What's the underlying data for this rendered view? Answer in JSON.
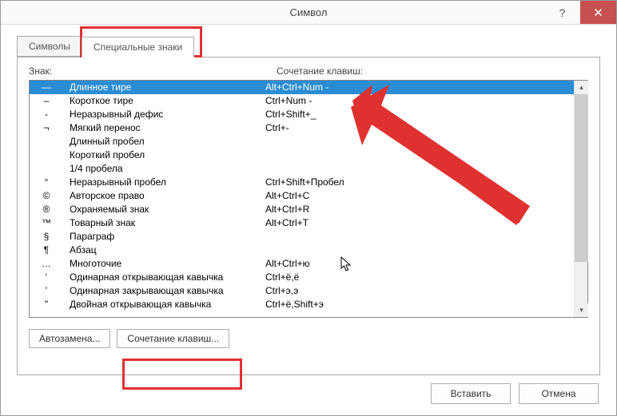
{
  "window": {
    "title": "Символ"
  },
  "tabs": {
    "symbols": "Символы",
    "special": "Специальные знаки"
  },
  "panel": {
    "header_sign": "Знак:",
    "header_shortcut": "Сочетание клавиш:"
  },
  "rows": [
    {
      "sym": "—",
      "name": "Длинное тире",
      "short": "Alt+Ctrl+Num -"
    },
    {
      "sym": "–",
      "name": "Короткое тире",
      "short": "Ctrl+Num -"
    },
    {
      "sym": "-",
      "name": "Неразрывный дефис",
      "short": "Ctrl+Shift+_"
    },
    {
      "sym": "¬",
      "name": "Мягкий перенос",
      "short": "Ctrl+-"
    },
    {
      "sym": "",
      "name": "Длинный пробел",
      "short": ""
    },
    {
      "sym": "",
      "name": "Короткий пробел",
      "short": ""
    },
    {
      "sym": "",
      "name": "1/4 пробела",
      "short": ""
    },
    {
      "sym": "°",
      "name": "Неразрывный пробел",
      "short": "Ctrl+Shift+Пробел"
    },
    {
      "sym": "©",
      "name": "Авторское право",
      "short": "Alt+Ctrl+C"
    },
    {
      "sym": "®",
      "name": "Охраняемый знак",
      "short": "Alt+Ctrl+R"
    },
    {
      "sym": "™",
      "name": "Товарный знак",
      "short": "Alt+Ctrl+T"
    },
    {
      "sym": "§",
      "name": "Параграф",
      "short": ""
    },
    {
      "sym": "¶",
      "name": "Абзац",
      "short": ""
    },
    {
      "sym": "…",
      "name": "Многоточие",
      "short": "Alt+Ctrl+ю"
    },
    {
      "sym": "‘",
      "name": "Одинарная открывающая кавычка",
      "short": "Ctrl+ё,ё"
    },
    {
      "sym": "’",
      "name": "Одинарная закрывающая кавычка",
      "short": "Ctrl+э,э"
    },
    {
      "sym": "\"",
      "name": "Двойная открывающая кавычка",
      "short": "Ctrl+ё,Shift+э"
    }
  ],
  "buttons": {
    "autocorrect": "Автозамена...",
    "shortcut": "Сочетание клавиш...",
    "insert": "Вставить",
    "cancel": "Отмена"
  }
}
